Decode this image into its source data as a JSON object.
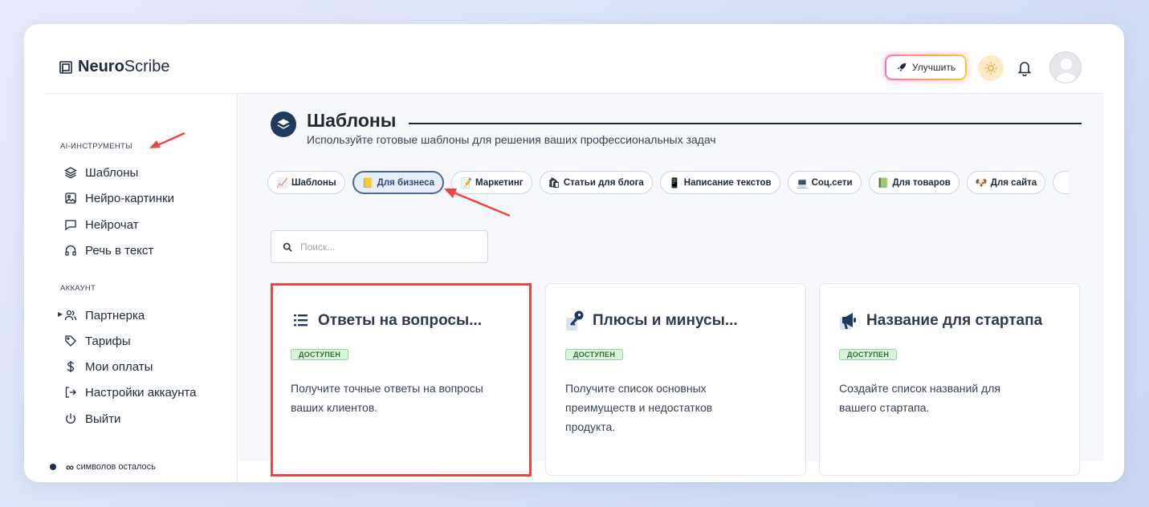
{
  "brand": {
    "name_bold": "Neuro",
    "name_light": "Scribe"
  },
  "header": {
    "upgrade_label": "Улучшить"
  },
  "sidebar": {
    "section_tools": "AI-ИНСТРУМЕНТЫ",
    "tools": [
      {
        "label": "Шаблоны",
        "icon": "layers-icon"
      },
      {
        "label": "Нейро-картинки",
        "icon": "image-icon"
      },
      {
        "label": "Нейрочат",
        "icon": "chat-icon"
      },
      {
        "label": "Речь в текст",
        "icon": "headphones-icon"
      }
    ],
    "section_account": "АККАУНТ",
    "account": [
      {
        "label": "Партнерка",
        "icon": "users-icon"
      },
      {
        "label": "Тарифы",
        "icon": "tag-icon"
      },
      {
        "label": "Мои оплаты",
        "icon": "dollar-icon"
      },
      {
        "label": "Настройки аккаунта",
        "icon": "login-icon"
      },
      {
        "label": "Выйти",
        "icon": "power-icon"
      }
    ],
    "credits_symbol": "∞",
    "credits_label": "символов осталось"
  },
  "main": {
    "title": "Шаблоны",
    "subtitle": "Используйте готовые шаблоны для решения ваших профессиональных задач",
    "chips": [
      {
        "label": "Шаблоны",
        "icon": "📈"
      },
      {
        "label": "Для бизнеса",
        "icon": "📒"
      },
      {
        "label": "Маркетинг",
        "icon": "📝"
      },
      {
        "label": "Статьи для блога",
        "icon": "🛍"
      },
      {
        "label": "Написание текстов",
        "icon": "📱"
      },
      {
        "label": "Соц.сети",
        "icon": "💻"
      },
      {
        "label": "Для товаров",
        "icon": "📗"
      },
      {
        "label": "Для сайта",
        "icon": "🐶"
      }
    ],
    "search_placeholder": "Поиск...",
    "cards": [
      {
        "title": "Ответы на вопросы...",
        "badge": "ДОСТУПЕН",
        "desc": "Получите точные ответы на вопросы ваших клиентов.",
        "icon": "list-icon"
      },
      {
        "title": "Плюсы и минусы...",
        "badge": "ДОСТУПЕН",
        "desc": "Получите список основных преимуществ и недостатков продукта.",
        "icon": "key-icon"
      },
      {
        "title": "Название для стартапа",
        "badge": "ДОСТУПЕН",
        "desc": "Создайте список названий для вашего стартапа.",
        "icon": "megaphone-icon"
      }
    ]
  },
  "colors": {
    "accent": "#1e3a5f",
    "highlight": "#ef4444",
    "badge_bg": "#d9f5d9"
  }
}
